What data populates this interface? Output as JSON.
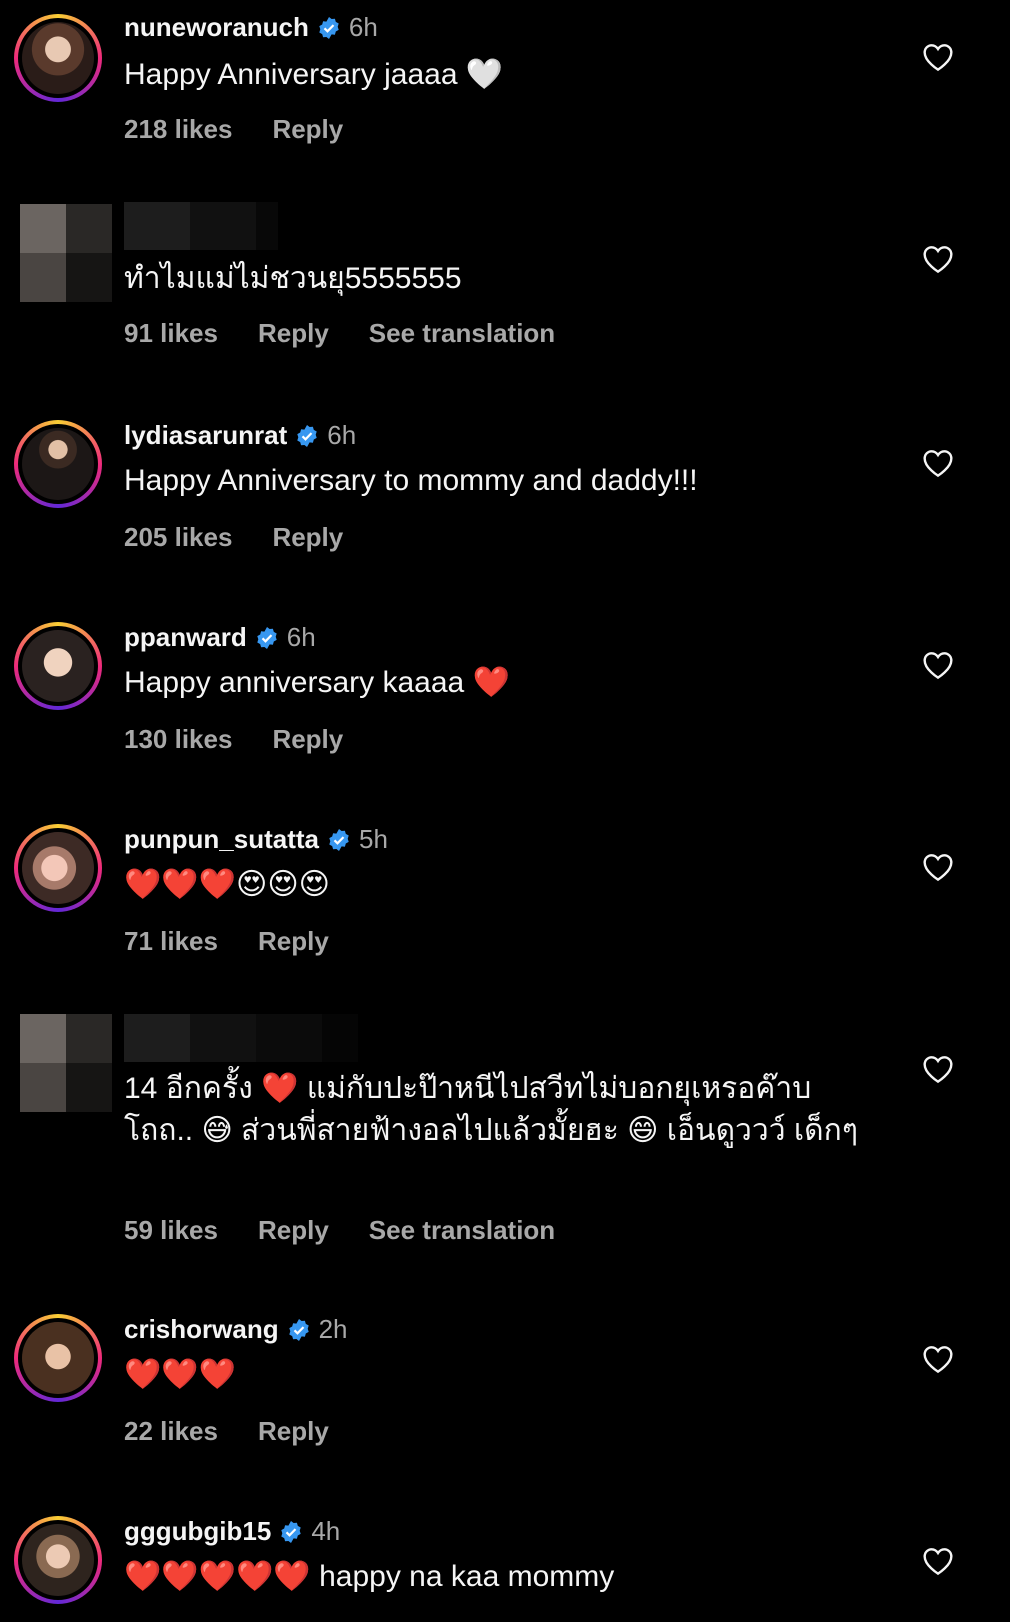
{
  "comments": [
    {
      "username": "nuneworanuch",
      "time": "6h",
      "text": "Happy Anniversary jaaaa 🤍",
      "likes": "218 likes",
      "reply": "Reply"
    },
    {
      "username": "",
      "time": "",
      "text": "ทำไมแม่ไม่ชวนยุ5555555",
      "likes": "91 likes",
      "reply": "Reply",
      "translate": "See translation"
    },
    {
      "username": "lydiasarunrat",
      "time": "6h",
      "text": "Happy Anniversary to mommy and daddy!!!",
      "likes": "205 likes",
      "reply": "Reply"
    },
    {
      "username": "ppanward",
      "time": "6h",
      "text": "Happy anniversary kaaaa ❤️",
      "likes": "130 likes",
      "reply": "Reply"
    },
    {
      "username": "punpun_sutatta",
      "time": "5h",
      "text": "❤️❤️❤️😍😍😍",
      "likes": "71 likes",
      "reply": "Reply"
    },
    {
      "username": "",
      "time": "",
      "text": "14 อีกครั้ง ❤️ แม่กับปะป๊าหนีไปสวีทไม่บอกยุเหรอค๊าบ โถถ.. 😅 ส่วนพี่สายฟ้างอลไปแล้วมั้ยฮะ 😄 เอ็นดูววว์ เด็กๆ",
      "likes": "59 likes",
      "reply": "Reply",
      "translate": "See translation"
    },
    {
      "username": "crishorwang",
      "time": "2h",
      "text": "❤️❤️❤️",
      "likes": "22 likes",
      "reply": "Reply"
    },
    {
      "username": "gggubgib15",
      "time": "4h",
      "text": "❤️❤️❤️❤️❤️ happy na kaa mommy",
      "likes": "",
      "reply": ""
    }
  ],
  "icons": {
    "like": "heart-outline-icon",
    "verified": "verified-badge-icon"
  },
  "colors": {
    "background": "#000000",
    "primary_text": "#f5f5f5",
    "secondary_text": "#a8a8a8",
    "verified": "#3797f0"
  }
}
